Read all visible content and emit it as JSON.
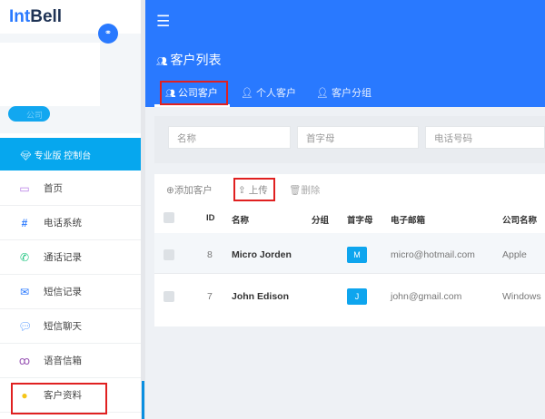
{
  "brand": {
    "part1": "Int",
    "part2": "Bell"
  },
  "sidebar": {
    "company_pill": "公司",
    "pro_label": "专业版 控制台",
    "items": [
      {
        "label": "首页",
        "icon": "monitor-icon",
        "color": "#b57be6"
      },
      {
        "label": "电话系统",
        "icon": "hash-icon",
        "color": "#2979ff"
      },
      {
        "label": "通话记录",
        "icon": "phone-icon",
        "color": "#19c37d"
      },
      {
        "label": "短信记录",
        "icon": "envelope-icon",
        "color": "#2979ff"
      },
      {
        "label": "短信聊天",
        "icon": "chat-icon",
        "color": "#5a9cff"
      },
      {
        "label": "语音信箱",
        "icon": "voicemail-icon",
        "color": "#9b59b6"
      },
      {
        "label": "客户资料",
        "icon": "user-circle-icon",
        "color": "#f5c518"
      }
    ]
  },
  "header": {
    "title": "客户列表",
    "tabs": [
      {
        "label": "公司客户"
      },
      {
        "label": "个人客户"
      },
      {
        "label": "客户分组"
      }
    ]
  },
  "filters": {
    "name_placeholder": "名称",
    "initial_placeholder": "首字母",
    "phone_placeholder": "电话号码"
  },
  "toolbar": {
    "add": "添加客户",
    "upload": "上传",
    "delete": "删除"
  },
  "table": {
    "columns": [
      "ID",
      "名称",
      "分组",
      "首字母",
      "电子邮箱",
      "公司名称"
    ],
    "rows": [
      {
        "id": "8",
        "name": "Micro Jorden",
        "group": "",
        "initial": "M",
        "email": "micro@hotmail.com",
        "company": "Apple"
      },
      {
        "id": "7",
        "name": "John Edison",
        "group": "",
        "initial": "J",
        "email": "john@gmail.com",
        "company": "Windows"
      }
    ]
  }
}
